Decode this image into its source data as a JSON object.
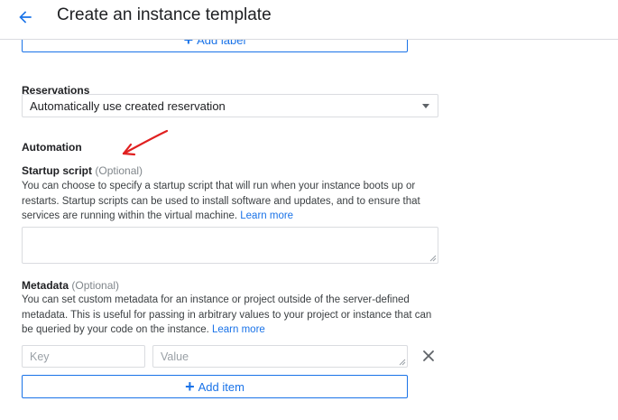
{
  "header": {
    "back_icon": "arrow-back-icon",
    "title": "Create an instance template"
  },
  "labels": {
    "add_label_button": "Add label",
    "plus_icon": "plus-icon"
  },
  "reservations": {
    "label": "Reservations",
    "selected": "Automatically use created reservation",
    "dropdown_icon": "dropdown-arrow-icon"
  },
  "automation": {
    "heading": "Automation",
    "annotation_icon": "red-arrow-annotation",
    "annotation_color": "#e02020"
  },
  "startup_script": {
    "label": "Startup script",
    "optional": "(Optional)",
    "help": "You can choose to specify a startup script that will run when your instance boots up or restarts. Startup scripts can be used to install software and updates, and to ensure that services are running within the virtual machine.",
    "learn_more": "Learn more",
    "value": ""
  },
  "metadata": {
    "label": "Metadata",
    "optional": "(Optional)",
    "help": "You can set custom metadata for an instance or project outside of the server-defined metadata. This is useful for passing in arbitrary values to your project or instance that can be queried by your code on the instance.",
    "learn_more": "Learn more",
    "key_placeholder": "Key",
    "value_placeholder": "Value",
    "remove_icon": "close-icon",
    "add_item_button": "Add item"
  },
  "colors": {
    "accent": "#1a73e8",
    "border": "#dadce0",
    "text": "#202124",
    "muted": "#80868b"
  }
}
